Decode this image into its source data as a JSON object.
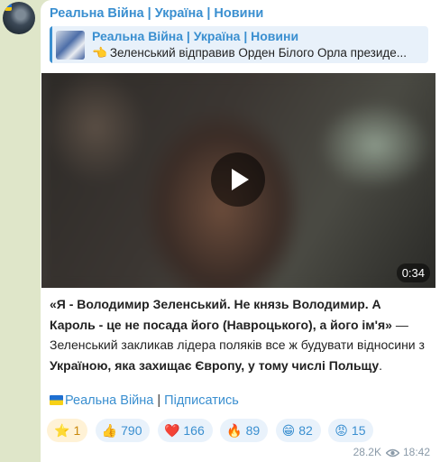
{
  "channel": {
    "name": "Реальна Війна | Україна | Новини"
  },
  "forward": {
    "source": "Реальна Війна | Україна | Новини",
    "emoji": "👈",
    "text": "Зеленський відправив Орден Білого Орла президе..."
  },
  "video": {
    "duration": "0:34"
  },
  "caption": {
    "quote": "«Я - Володимир Зеленський. Не князь Володимир. А Кароль - це не посада його (Навроцького), а його ім'я»",
    "text1": " — Зеленський закликав лідера поляків все ж будувати відносини з ",
    "bold": "Україною, яка захищає Європу, у тому числі Польщу",
    "text2": "."
  },
  "signature": {
    "channel": "Реальна Війна",
    "separator": " | ",
    "subscribe": "Підписатись"
  },
  "reactions": [
    {
      "emoji": "⭐",
      "count": "1"
    },
    {
      "emoji": "👍",
      "count": "790"
    },
    {
      "emoji": "❤️",
      "count": "166"
    },
    {
      "emoji": "🔥",
      "count": "89"
    },
    {
      "emoji": "😁",
      "count": "82"
    },
    {
      "emoji": "😡",
      "count": "15"
    }
  ],
  "meta": {
    "views": "28.2K",
    "time": "18:42"
  },
  "colors": {
    "accent": "#3a8fd0",
    "background": "#dfe6c9"
  }
}
